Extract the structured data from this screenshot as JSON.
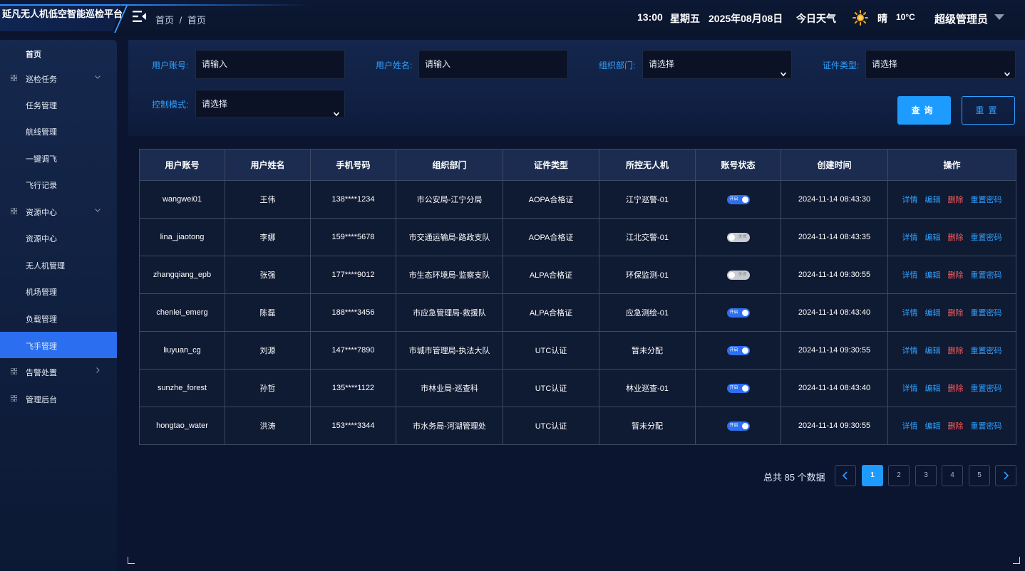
{
  "header": {
    "title": "延凡无人机低空智能巡检平台",
    "breadcrumbs": [
      "首页",
      "/",
      "首页"
    ],
    "time": "13:00",
    "weekday": "星期五",
    "date": "2025年08月08日",
    "weather_label": "今日天气",
    "weather": "晴",
    "temperature": "10°C",
    "user": "超级管理员",
    "accent": "#2c8cff"
  },
  "sidebar": {
    "items": [
      {
        "label": "首页",
        "type": "link",
        "bold": true
      },
      {
        "label": "巡检任务",
        "type": "group",
        "expanded": true
      },
      {
        "label": "任务管理",
        "type": "child"
      },
      {
        "label": "航线管理",
        "type": "child"
      },
      {
        "label": "一键调飞",
        "type": "child"
      },
      {
        "label": "飞行记录",
        "type": "child"
      },
      {
        "label": "资源中心",
        "type": "group",
        "expanded": true
      },
      {
        "label": "资源中心",
        "type": "child"
      },
      {
        "label": "无人机管理",
        "type": "child"
      },
      {
        "label": "机场管理",
        "type": "child"
      },
      {
        "label": "负载管理",
        "type": "child"
      },
      {
        "label": "飞手管理",
        "type": "child",
        "active": true
      },
      {
        "label": "告警处置",
        "type": "group",
        "expanded": false
      },
      {
        "label": "管理后台",
        "type": "group-noarrow"
      }
    ],
    "active_color": "#2b6ff0"
  },
  "filters": {
    "account_label": "用户账号:",
    "account_placeholder": "请输入",
    "name_label": "用户姓名:",
    "name_placeholder": "请输入",
    "dept_label": "组织部门:",
    "dept_value": "请选择",
    "cert_label": "证件类型:",
    "cert_value": "请选择",
    "mode_label": "控制模式:",
    "mode_value": "请选择",
    "query_label": "查询",
    "reset_label": "重置"
  },
  "table": {
    "columns": [
      "用户账号",
      "用户姓名",
      "手机号码",
      "组织部门",
      "证件类型",
      "所控无人机",
      "账号状态",
      "创建时间",
      "操作"
    ],
    "status_on": "开启",
    "status_off": "关闭",
    "actions": [
      "详情",
      "编辑",
      "删除",
      "重置密码"
    ],
    "rows": [
      {
        "account": "wangwei01",
        "name": "王伟",
        "phone": "138****1234",
        "dept": "市公安局-江宁分局",
        "cert": "AOPA合格证",
        "drone": "江宁巡警-01",
        "enabled": true,
        "created": "2024-11-14 08:43:30"
      },
      {
        "account": "lina_jiaotong",
        "name": "李娜",
        "phone": "159****5678",
        "dept": "市交通运输局-路政支队",
        "cert": "AOPA合格证",
        "drone": "江北交警-01",
        "enabled": false,
        "created": "2024-11-14 08:43:35"
      },
      {
        "account": "zhangqiang_epb",
        "name": "张强",
        "phone": "177****9012",
        "dept": "市生态环境局-监察支队",
        "cert": "ALPA合格证",
        "drone": "环保监测-01",
        "enabled": false,
        "created": "2024-11-14 09:30:55"
      },
      {
        "account": "chenlei_emerg",
        "name": "陈磊",
        "phone": "188****3456",
        "dept": "市应急管理局-救援队",
        "cert": "ALPA合格证",
        "drone": "应急测绘-01",
        "enabled": true,
        "created": "2024-11-14 08:43:40"
      },
      {
        "account": "liuyuan_cg",
        "name": "刘源",
        "phone": "147****7890",
        "dept": "市城市管理局-执法大队",
        "cert": "UTC认证",
        "drone": "暂未分配",
        "enabled": true,
        "created": "2024-11-14 09:30:55"
      },
      {
        "account": "sunzhe_forest",
        "name": "孙哲",
        "phone": "135****1122",
        "dept": "市林业局-巡查科",
        "cert": "UTC认证",
        "drone": "林业巡查-01",
        "enabled": true,
        "created": "2024-11-14 08:43:40"
      },
      {
        "account": "hongtao_water",
        "name": "洪涛",
        "phone": "153****3344",
        "dept": "市水务局-河湖管理处",
        "cert": "UTC认证",
        "drone": "暂未分配",
        "enabled": true,
        "created": "2024-11-14 09:30:55"
      }
    ]
  },
  "pagination": {
    "total_text": "总共 85 个数据",
    "pages": [
      "1",
      "2",
      "3",
      "4",
      "5"
    ],
    "current": "1"
  }
}
